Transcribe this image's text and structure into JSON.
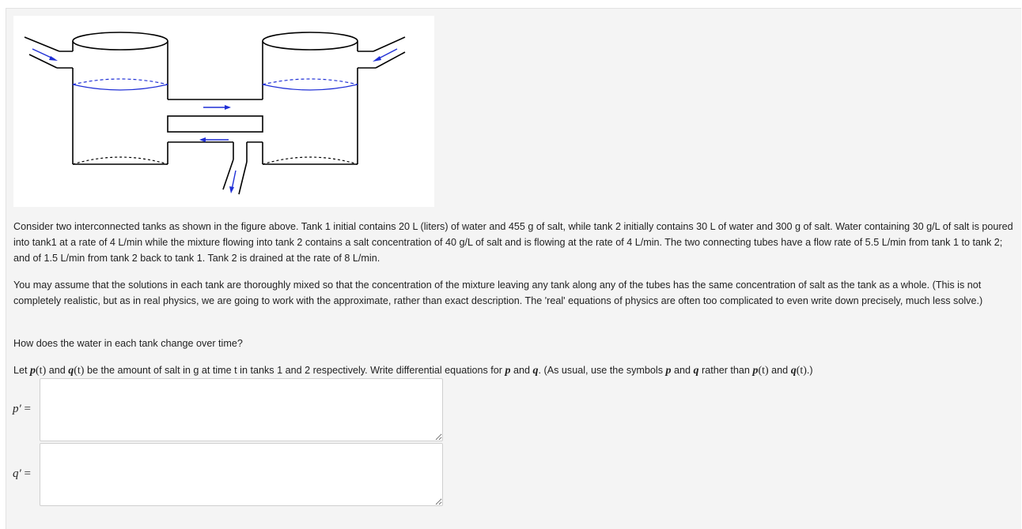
{
  "question": {
    "paragraph1": "Consider two interconnected tanks as shown in the figure above. Tank 1 initial contains 20 L (liters) of water and 455 g of salt, while tank 2 initially contains 30 L of water and 300 g of salt. Water containing 30 g/L of salt is poured into tank1 at a rate of 4 L/min while the mixture flowing into tank 2 contains a salt concentration of 40 g/L of salt and is flowing at the rate of 4 L/min. The two connecting tubes have a flow rate of 5.5 L/min from tank 1 to tank 2; and of 1.5 L/min from tank 2 back to tank 1. Tank 2 is drained at the rate of 8 L/min.",
    "paragraph2": "You may assume that the solutions in each tank are thoroughly mixed so that the concentration of the mixture leaving any tank along any of the tubes has the same concentration of salt as the tank as a whole. (This is not completely realistic, but as in real physics, we are going to work with the approximate, rather than exact description. The 'real' equations of physics are often too complicated to even write down precisely, much less solve.)",
    "paragraph3": "How does the water in each tank change over time?",
    "paragraph4": {
      "t1": "Let ",
      "m1": "p",
      "m1b": "(t)",
      "t2": " and ",
      "m2": "q",
      "m2b": "(t)",
      "t3": " be the amount of salt in g at time t in tanks 1 and 2 respectively. Write differential equations for ",
      "m3": "p",
      "t4": " and ",
      "m4": "q",
      "t5": ". (As usual, use the symbols ",
      "m5": "p",
      "t6": " and ",
      "m6": "q",
      "t7": " rather than ",
      "m7": "p",
      "m7b": "(t)",
      "t8": " and ",
      "m8": "q",
      "m8b": "(t)",
      "t9": ".)"
    }
  },
  "answers": {
    "p_label_var": "p′",
    "p_label_eq": " =",
    "p_value": "",
    "q_label_var": "q′",
    "q_label_eq": " =",
    "q_value": ""
  },
  "figure": {
    "tank_outline_color": "#000000",
    "water_line_color": "#1f2fd6",
    "arrow_color": "#1f2fd6"
  }
}
